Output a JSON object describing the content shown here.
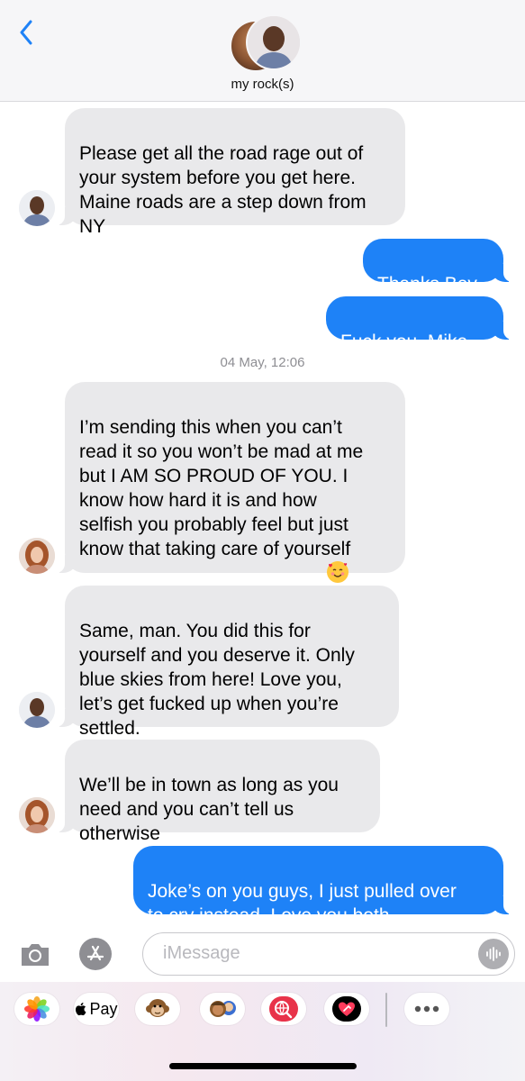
{
  "header": {
    "contact_name": "my rock(s)",
    "back_icon": "chevron-left-icon",
    "accent_color": "#1e82f7"
  },
  "messages": [
    {
      "side": "received",
      "sender": "Mike",
      "text": "Please get all the road rage out of\nyour system before you get here.\nMaine roads are a step down from\nNY"
    },
    {
      "side": "sent",
      "text": "Thanks Bev."
    },
    {
      "side": "sent",
      "text": "Fuck you, Mike."
    },
    {
      "side": "received",
      "sender": "Bev",
      "text": "I’m sending this when you can’t\nread it so you won’t be mad at me\nbut I AM SO PROUD OF YOU. I\nknow how hard it is and how\nselfish you probably feel but just\nknow that taking care of yourself\nis not selfish!!!!! I love you!!!!! ",
      "emoji": "smiling-face-with-hearts"
    },
    {
      "side": "received",
      "sender": "Mike",
      "text": "Same, man. You did this for\nyourself and you deserve it. Only\nblue skies from here! Love you,\nlet’s get fucked up when you’re\nsettled."
    },
    {
      "side": "received",
      "sender": "Bev",
      "text": "We’ll be in town as long as you\nneed and you can’t tell us\notherwise"
    },
    {
      "side": "sent",
      "text": "Joke’s on you guys, I just pulled over\nto cry instead. Love you both."
    }
  ],
  "timestamp": "04 May, 12:06",
  "input": {
    "placeholder": "iMessage"
  },
  "app_drawer": {
    "apple_pay_label": "Pay",
    "items": [
      "photos-icon",
      "apple-pay-icon",
      "monkey-memoji-icon",
      "memoji-stickers-icon",
      "web-search-icon",
      "digital-touch-icon",
      "more-icon"
    ]
  },
  "colors": {
    "sent_bubble": "#1e82f7",
    "received_bubble": "#e9e9eb"
  }
}
